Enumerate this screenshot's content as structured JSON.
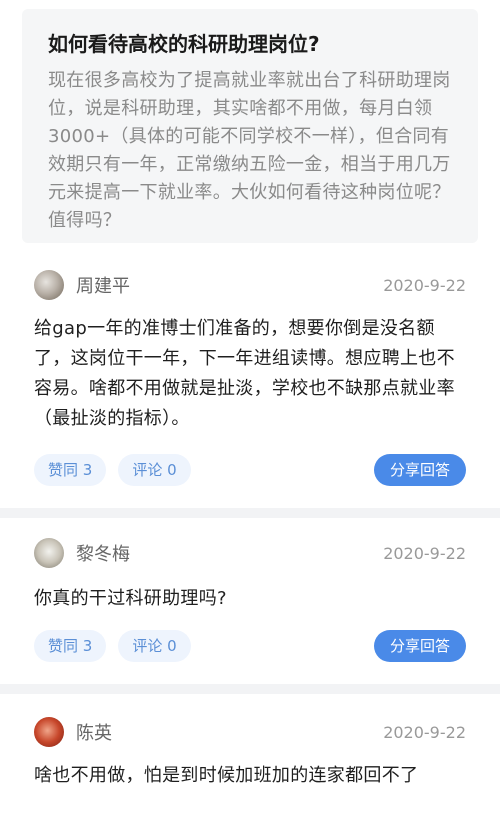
{
  "question": {
    "title": "如何看待高校的科研助理岗位?",
    "body": "现在很多高校为了提高就业率就出台了科研助理岗位，说是科研助理，其实啥都不用做，每月白领3000+（具体的可能不同学校不一样），但合同有效期只有一年，正常缴纳五险一金，相当于用几万元来提高一下就业率。大伙如何看待这种岗位呢？值得吗？"
  },
  "answers": [
    {
      "author": "周建平",
      "date": "2020-9-22",
      "text": "给gap一年的准博士们准备的，想要你倒是没名额了，这岗位干一年，下一年进组读博。想应聘上也不容易。啥都不用做就是扯淡，学校也不缺那点就业率（最扯淡的指标）。",
      "like_label": "赞同 3",
      "comment_label": "评论 0",
      "share_label": "分享回答"
    },
    {
      "author": "黎冬梅",
      "date": "2020-9-22",
      "text": "你真的干过科研助理吗?",
      "like_label": "赞同 3",
      "comment_label": "评论 0",
      "share_label": "分享回答"
    },
    {
      "author": "陈英",
      "date": "2020-9-22",
      "text": "啥也不用做，怕是到时候加班加的连家都回不了"
    }
  ],
  "colors": {
    "accent": "#4a8ae8",
    "pill_bg": "#eef4fd",
    "pill_text": "#5b8fd6"
  }
}
